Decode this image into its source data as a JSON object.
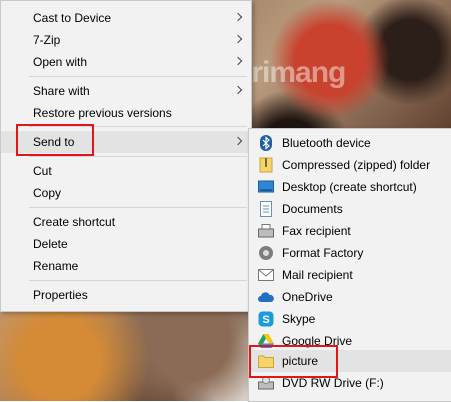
{
  "context_menu": {
    "items": [
      {
        "label": "Cast to Device",
        "submenu": true
      },
      {
        "label": "7-Zip",
        "submenu": true
      },
      {
        "label": "Open with",
        "submenu": true
      },
      {
        "label": "Share with",
        "submenu": true
      },
      {
        "label": "Restore previous versions",
        "submenu": false
      },
      {
        "label": "Send to",
        "submenu": true,
        "highlighted": true
      },
      {
        "label": "Cut",
        "submenu": false
      },
      {
        "label": "Copy",
        "submenu": false
      },
      {
        "label": "Create shortcut",
        "submenu": false
      },
      {
        "label": "Delete",
        "submenu": false
      },
      {
        "label": "Rename",
        "submenu": false
      },
      {
        "label": "Properties",
        "submenu": false
      }
    ]
  },
  "send_to_menu": {
    "items": [
      {
        "label": "Bluetooth device",
        "icon": "bluetooth-icon"
      },
      {
        "label": "Compressed (zipped) folder",
        "icon": "zip-folder-icon"
      },
      {
        "label": "Desktop (create shortcut)",
        "icon": "desktop-icon"
      },
      {
        "label": "Documents",
        "icon": "documents-icon"
      },
      {
        "label": "Fax recipient",
        "icon": "fax-icon"
      },
      {
        "label": "Format Factory",
        "icon": "format-factory-icon"
      },
      {
        "label": "Mail recipient",
        "icon": "mail-icon"
      },
      {
        "label": "OneDrive",
        "icon": "onedrive-icon"
      },
      {
        "label": "Skype",
        "icon": "skype-icon"
      },
      {
        "label": "Google Drive",
        "icon": "google-drive-icon"
      },
      {
        "label": "picture",
        "icon": "folder-icon",
        "highlighted": true
      },
      {
        "label": "DVD RW Drive (F:)",
        "icon": "dvd-drive-icon"
      }
    ]
  },
  "watermark": {
    "text": "uantrimang"
  },
  "colors": {
    "highlight_box": "#e0161b",
    "menu_bg": "#f2f2f2",
    "hover_bg": "#e3e3e3"
  }
}
